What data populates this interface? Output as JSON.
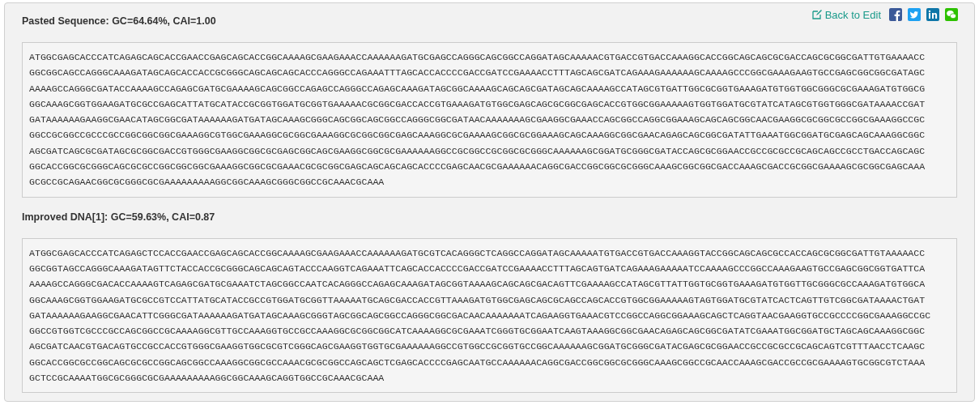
{
  "actions": {
    "back_link": "Back to Edit"
  },
  "sections": [
    {
      "title": "Pasted Sequence: GC=64.64%, CAI=1.00",
      "lines": [
        "ATGGCGAGCACCCATCAGAGCAGCACCGAACCGAGCAGCACCGGCAAAAGCGAAGAAACCAAAAAAGATGCGAGCCAGGGCAGCGGCCAGGATAGCAAAAACGTGACCGTGACCAAAGGCACCGGCAGCAGCGCGACCAGCGCGGCGATTGTGAAAACC",
        "GGCGGCAGCCAGGGCAAAGATAGCAGCACCACCGCGGGCAGCAGCAGCACCCAGGGCCAGAAATTTAGCACCACCCCGACCGATCCGAAAACCTTTAGCAGCGATCAGAAAGAAAAAAGCAAAAGCCCGGCGAAAGAAGTGCCGAGCGGCGGCGATAGC",
        "AAAAGCCAGGGCGATACCAAAAGCCAGAGCGATGCGAAAAGCAGCGGCCAGAGCCAGGGCCAGAGCAAAGATAGCGGCAAAAGCAGCAGCGATAGCAGCAAAAGCCATAGCGTGATTGGCGCGGTGAAAGATGTGGTGGCGGGCGCGAAAGATGTGGCG",
        "GGCAAAGCGGTGGAAGATGCGCCGAGCATTATGCATACCGCGGTGGATGCGGTGAAAAACGCGGCGACCACCGTGAAAGATGTGGCGAGCAGCGCGGCGAGCACCGTGGCGGAAAAAGTGGTGGATGCGTATCATAGCGTGGTGGGCGATAAAACCGAT",
        "GATAAAAAAGAAGGCGAACATAGCGGCGATAAAAAAGATGATAGCAAAGCGGGCAGCGGCAGCGGCCAGGGCGGCGATAACAAAAAAAGCGAAGGCGAAACCAGCGGCCAGGCGGAAAGCAGCAGCGGCAACGAAGGCGCGGCGCCGGCGAAAGGCCGC",
        "GGCCGCGGCCGCCCGCCGGCGGCGGCGAAAGGCGTGGCGAAAGGCGCGGCGAAAGGCGCGGCGGCGAGCAAAGGCGCGAAAAGCGGCGCGGAAAGCAGCAAAGGCGGCGAACAGAGCAGCGGCGATATTGAAATGGCGGATGCGAGCAGCAAAGGCGGC",
        "AGCGATCAGCGCGATAGCGCGGCGACCGTGGGCGAAGGCGGCGCGAGCGGCAGCGAAGGCGGCGCGAAAAAAGGCCGCGGCCGCGGCGCGGGCAAAAAAGCGGATGCGGGCGATACCAGCGCGGAACCGCCGCGCCGCAGCAGCCGCCTGACCAGCAGC",
        "GGCACCGGCGCGGGCAGCGCGCCGGCGGCGGCGAAAGGCGGCGCGAAACGCGCGGCGAGCAGCAGCAGCACCCCGAGCAACGCGAAAAAACAGGCGACCGGCGGCGCGGGCAAAGCGGCGGCGACCAAAGCGACCGCGGCGAAAAGCGCGGCGAGCAAA",
        "GCGCCGCAGAACGGCGCGGGCGCGAAAAAAAAAGGCGGCAAAGCGGGCGGCCGCAAACGCAAA"
      ]
    },
    {
      "title": "Improved DNA[1]: GC=59.63%, CAI=0.87",
      "lines": [
        "ATGGCGAGCACCCATCAGAGCTCCACCGAACCGAGCAGCACCGGCAAAAGCGAAGAAACCAAAAAAGATGCGTCACAGGGCTCAGGCCAGGATAGCAAAAATGTGACCGTGACCAAAGGTACCGGCAGCAGCGCCACCAGCGCGGCGATTGTAAAAACC",
        "GGCGGTAGCCAGGGCAAAGATAGTTCTACCACCGCGGGCAGCAGCAGTACCCAAGGTCAGAAATTCAGCACCACCCCGACCGATCCGAAAACCTTTAGCAGTGATCAGAAAGAAAAATCCAAAAGCCCGGCCAAAGAAGTGCCGAGCGGCGGTGATTCA",
        "AAAAGCCAGGGCGACACCAAAAGTCAGAGCGATGCGAAATCTAGCGGCCAATCACAGGGCCAGAGCAAAGATAGCGGTAAAAGCAGCAGCGACAGTTCGAAAAGCCATAGCGTTATTGGTGCGGTGAAAGATGTGGTTGCGGGCGCCAAAGATGTGGCA",
        "GGCAAAGCGGTGGAAGATGCGCCGTCCATTATGCATACCGCCGTGGATGCGGTTAAAAATGCAGCGACCACCGTTAAAGATGTGGCGAGCAGCGCAGCCAGCACCGTGGCGGAAAAAGTAGTGGATGCGTATCACTCAGTTGTCGGCGATAAAACTGAT",
        "GATAAAAAAGAAGGCGAACATTCGGGCGATAAAAAAGATGATAGCAAAGCGGGTAGCGGCAGCGGCCAGGGCGGCGACAACAAAAAAATCAGAAGGTGAAACGTCCGGCCAGGCGGAAAGCAGCTCAGGTAACGAAGGTGCCGCCCCGGCGAAAGGCCGC",
        "GGCCGTGGTCGCCCGCCAGCGGCCGCAAAAGGCGTTGCCAAAGGTGCCGCCAAAGGCGCGGCGGCATCAAAAGGCGCGAAATCGGGTGCGGAATCAAGTAAAGGCGGCGAACAGAGCAGCGGCGATATCGAAATGGCGGATGCTAGCAGCAAAGGCGGC",
        "AGCGATCAACGTGACAGTGCCGCCACCGTGGGCGAAGGTGGCGCGTCGGGCAGCGAAGGTGGTGCGAAAAAAGGCCGTGGCCGCGGTGCCGGCAAAAAAGCGGATGCGGGCGATACGAGCGCGGAACCGCCGCGCCGCAGCAGTCGTTTAACCTCAAGC",
        "GGCACCGGCGCCGGCAGCGCGCCGGCAGCGGCCAAAGGCGGCGCCAAACGCGCGGCCAGCAGCTCGAGCACCCCGAGCAATGCCAAAAAACAGGCGACCGGCGGCGCGGGCAAAGCGGCCGCAACCAAAGCGACCGCCGCGAAAAGTGCGGCGTCTAAA",
        "GCTCCGCAAAATGGCGCGGGCGCGAAAAAAAAAGGCGGCAAAGCAGGTGGCCGCAAACGCAAA"
      ]
    }
  ]
}
